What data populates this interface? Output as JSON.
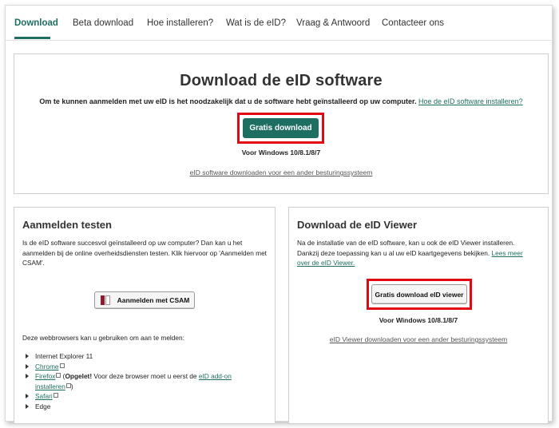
{
  "nav": {
    "tabs": [
      {
        "label": "Download"
      },
      {
        "label": "Beta download"
      },
      {
        "label": "Hoe installeren?"
      },
      {
        "label": "Wat is de eID?"
      },
      {
        "label": "Vraag & Antwoord"
      },
      {
        "label": "Contacteer ons"
      }
    ]
  },
  "main": {
    "title": "Download de eID software",
    "intro": "Om te kunnen aanmelden met uw eID is het noodzakelijk dat u de software hebt geïnstalleerd op uw computer.",
    "intro_link": "Hoe de eID software installeren?",
    "button": "Gratis download",
    "os_note": "Voor Windows 10/8.1/8/7",
    "other_os_link": "eID software downloaden voor een ander besturingssysteem"
  },
  "test": {
    "title": "Aanmelden testen",
    "text": "Is de eID software succesvol geïnstalleerd op uw computer? Dan kan u het aanmelden bij de online overheidsdiensten testen. Klik hiervoor op 'Aanmelden met CSAM'.",
    "button": "Aanmelden met CSAM",
    "browsers_intro": "Deze webbrowsers kan u gebruiken om aan te melden:",
    "browsers": {
      "ie": "Internet Explorer 11",
      "chrome": "Chrome",
      "firefox": "Firefox",
      "firefox_warn_bold": "Opgelet!",
      "firefox_warn_text": "Voor deze browser moet u eerst de",
      "firefox_addon_link": "eID add-on installeren",
      "safari": "Safari",
      "edge": "Edge"
    }
  },
  "viewer": {
    "title": "Download de eID Viewer",
    "text": "Na de installatie van de eID software, kan u ook de eID Viewer installeren. Dankzij deze toepassing kan u al uw eID kaartgegevens bekijken.",
    "text_link": "Lees meer over de eID Viewer.",
    "button": "Gratis download eID viewer",
    "os_note": "Voor Windows 10/8.1/8/7",
    "other_os_link": "eID Viewer downloaden voor een ander besturingssysteem"
  },
  "colors": {
    "accent": "#1e6e62",
    "highlight": "#e30613"
  }
}
